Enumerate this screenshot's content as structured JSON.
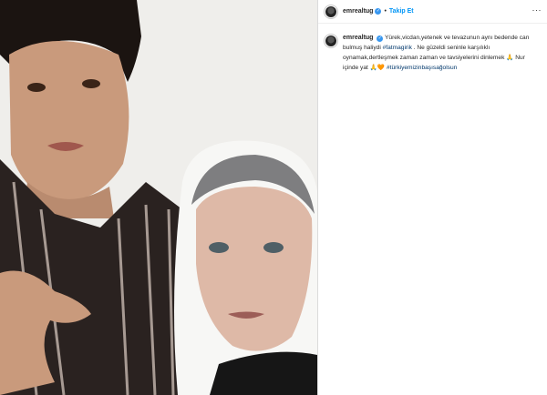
{
  "post": {
    "username": "emrealtug",
    "follow_label": "Takip Et",
    "dot": "•",
    "more_label": "···",
    "verified_mark": "✓"
  },
  "caption": {
    "username": "emrealtug",
    "text1": "Yürek,vicdan,yetenek ve tevazunun aynı bedende can bulmuş haliydi",
    "hashtag1": "#fatmagirik",
    "text2": ". Ne güzeldi seninle karşılıklı oynamak,dertleşmek zaman zaman ve tavsiyelerini dinlemek",
    "emoji1": "🙏",
    "text3": " Nur içinde yat ",
    "emoji2": "🙏🧡",
    "hashtag2": "#türkiyemizinbaşısağolsun"
  },
  "icons": {
    "verified": "verified-badge-icon",
    "more": "more-options-icon"
  },
  "colors": {
    "follow": "#0095f6",
    "verified": "#3897f0",
    "hashtag": "#00376b",
    "text": "#262626"
  }
}
